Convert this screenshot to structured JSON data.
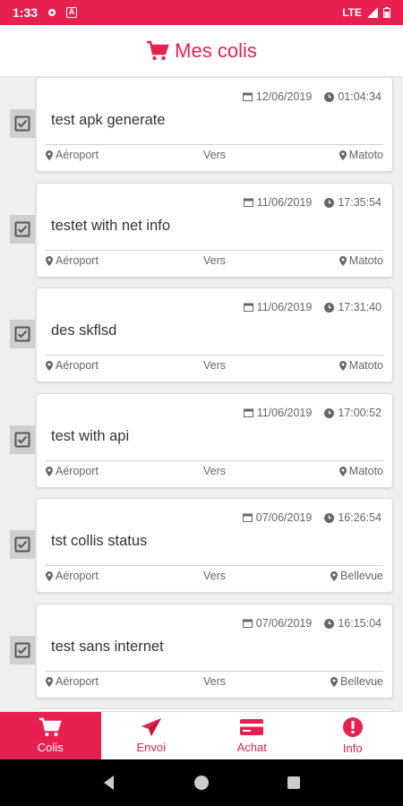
{
  "status_bar": {
    "time": "1:33",
    "network": "LTE",
    "icons": [
      "gear-icon",
      "a-badge-icon",
      "signal-icon",
      "battery-icon"
    ]
  },
  "header": {
    "title": "Mes colis",
    "icon": "cart-icon"
  },
  "colors": {
    "accent": "#e8204f",
    "card_bg": "#ffffff",
    "list_bg": "#efefef"
  },
  "parcels": [
    {
      "date": "12/06/2019",
      "time": "01:04:34",
      "name": "test apk generate",
      "from": "Aéroport",
      "via": "Vers",
      "to": "Matoto"
    },
    {
      "date": "11/06/2019",
      "time": "17:35:54",
      "name": "testet with net info",
      "from": "Aéroport",
      "via": "Vers",
      "to": "Matoto"
    },
    {
      "date": "11/06/2019",
      "time": "17:31:40",
      "name": "des skflsd",
      "from": "Aéroport",
      "via": "Vers",
      "to": "Matoto"
    },
    {
      "date": "11/06/2019",
      "time": "17:00:52",
      "name": "test with api",
      "from": "Aéroport",
      "via": "Vers",
      "to": "Matoto"
    },
    {
      "date": "07/06/2019",
      "time": "16:26:54",
      "name": "tst collis status",
      "from": "Aéroport",
      "via": "Vers",
      "to": "Bellevue"
    },
    {
      "date": "07/06/2019",
      "time": "16:15:04",
      "name": "test sans internet",
      "from": "Aéroport",
      "via": "Vers",
      "to": "Bellevue"
    }
  ],
  "tabs": [
    {
      "label": "Colis",
      "icon": "cart-icon",
      "active": true
    },
    {
      "label": "Envoi",
      "icon": "send-icon",
      "active": false
    },
    {
      "label": "Achat",
      "icon": "card-icon",
      "active": false
    },
    {
      "label": "Info",
      "icon": "info-icon",
      "active": false
    }
  ]
}
